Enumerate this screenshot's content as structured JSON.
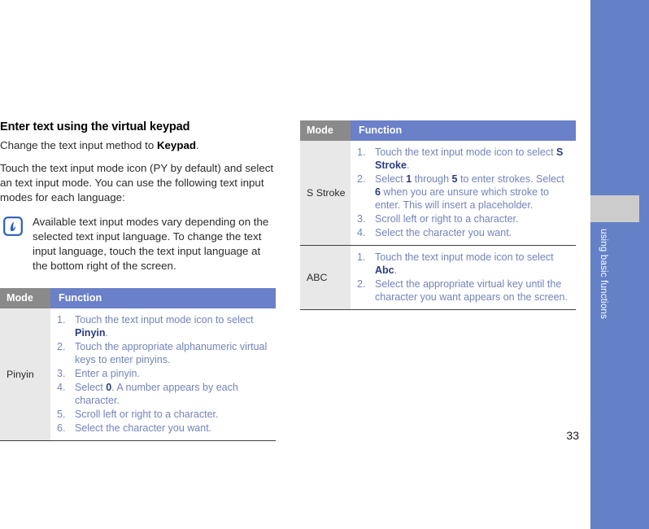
{
  "document": {
    "page_number": "33",
    "side_tab_label": "using basic functions"
  },
  "colors": {
    "accent_blue": "#6480c6",
    "header_mode_gray": "#8a8a8a",
    "header_function_blue": "#6a80c8",
    "mode_cell_gray": "#e8e8e8",
    "step_text_blue": "#7383bb",
    "step_bold_blue": "#2b3c80",
    "side_gray_box": "#cccccc"
  },
  "left_column": {
    "section_title": "Enter text using the virtual keypad",
    "intro_1_before": "Change the text input method to ",
    "intro_1_bold": "Keypad",
    "intro_1_after": ".",
    "intro_2": "Touch the text input mode icon (PY by default) and select an text input mode. You can use the following text input modes for each language:",
    "note": {
      "icon": "note-pen-icon",
      "text": "Available text input modes vary depending on the selected text input language. To change the text input language, touch the text input language at the bottom right of the screen."
    },
    "table": {
      "headers": {
        "mode": "Mode",
        "function": "Function"
      },
      "rows": [
        {
          "mode": "Pinyin",
          "steps": [
            {
              "parts": [
                {
                  "text": "Touch the text input mode icon to select ",
                  "bold": false
                },
                {
                  "text": "Pinyin",
                  "bold": true
                },
                {
                  "text": ".",
                  "bold": false
                }
              ]
            },
            {
              "parts": [
                {
                  "text": "Touch the appropriate alphanumeric virtual keys to enter pinyins.",
                  "bold": false
                }
              ]
            },
            {
              "parts": [
                {
                  "text": "Enter a pinyin.",
                  "bold": false
                }
              ]
            },
            {
              "parts": [
                {
                  "text": "Select ",
                  "bold": false
                },
                {
                  "text": "0",
                  "bold": true
                },
                {
                  "text": ". A number appears by each character.",
                  "bold": false
                }
              ]
            },
            {
              "parts": [
                {
                  "text": "Scroll left or right to a character.",
                  "bold": false
                }
              ]
            },
            {
              "parts": [
                {
                  "text": "Select the character you want.",
                  "bold": false
                }
              ]
            }
          ]
        }
      ]
    }
  },
  "right_column": {
    "table": {
      "headers": {
        "mode": "Mode",
        "function": "Function"
      },
      "rows": [
        {
          "mode": "S Stroke",
          "steps": [
            {
              "parts": [
                {
                  "text": "Touch the text input mode icon to select ",
                  "bold": false
                },
                {
                  "text": "S Stroke",
                  "bold": true
                },
                {
                  "text": ".",
                  "bold": false
                }
              ]
            },
            {
              "parts": [
                {
                  "text": "Select ",
                  "bold": false
                },
                {
                  "text": "1",
                  "bold": true
                },
                {
                  "text": " through ",
                  "bold": false
                },
                {
                  "text": "5",
                  "bold": true
                },
                {
                  "text": " to enter strokes. Select ",
                  "bold": false
                },
                {
                  "text": "6",
                  "bold": true
                },
                {
                  "text": " when you are unsure which stroke to enter. This will insert a placeholder.",
                  "bold": false
                }
              ]
            },
            {
              "parts": [
                {
                  "text": "Scroll left or right to a character.",
                  "bold": false
                }
              ]
            },
            {
              "parts": [
                {
                  "text": "Select the character you want.",
                  "bold": false
                }
              ]
            }
          ]
        },
        {
          "mode": "ABC",
          "steps": [
            {
              "parts": [
                {
                  "text": "Touch the text input mode icon to select ",
                  "bold": false
                },
                {
                  "text": "Abc",
                  "bold": true
                },
                {
                  "text": ".",
                  "bold": false
                }
              ]
            },
            {
              "parts": [
                {
                  "text": "Select the appropriate virtual key until the character you want appears on the screen.",
                  "bold": false
                }
              ]
            }
          ]
        }
      ]
    }
  }
}
